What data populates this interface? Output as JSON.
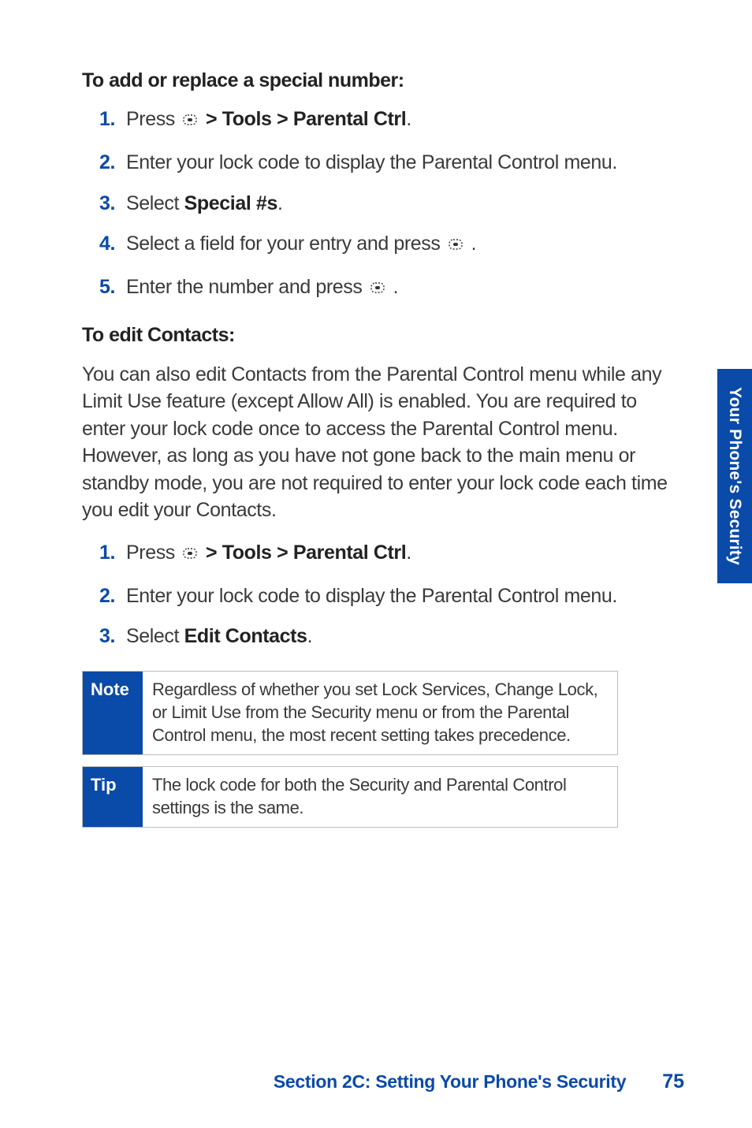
{
  "sideTab": "Your Phone's Security",
  "section1": {
    "heading": "To add or replace a special number:",
    "steps": [
      {
        "num": "1.",
        "pre": "Press ",
        "bold": " > Tools > Parental Ctrl",
        "post": ".",
        "icon": true
      },
      {
        "num": "2.",
        "text": "Enter your lock code to display the Parental Control menu."
      },
      {
        "num": "3.",
        "pre": "Select ",
        "bold": "Special #s",
        "post": "."
      },
      {
        "num": "4.",
        "pre": "Select a field for your entry and press ",
        "post": " .",
        "iconAfter": true
      },
      {
        "num": "5.",
        "pre": "Enter the number and press ",
        "post": " .",
        "iconAfter": true
      }
    ]
  },
  "section2": {
    "heading": "To edit Contacts:",
    "para": "You can also edit Contacts from the Parental Control menu while any Limit Use feature (except Allow All) is enabled. You are required to enter your lock code once to access the Parental Control menu. However, as long as you have not gone back to the main menu or standby mode, you are not required to enter your lock code each time you edit your Contacts.",
    "steps": [
      {
        "num": "1.",
        "pre": "Press ",
        "bold": " > Tools > Parental Ctrl",
        "post": ".",
        "icon": true
      },
      {
        "num": "2.",
        "text": "Enter your lock code to display the Parental Control menu."
      },
      {
        "num": "3.",
        "pre": "Select ",
        "bold": "Edit Contacts",
        "post": "."
      }
    ]
  },
  "note": {
    "label": "Note",
    "body": "Regardless of whether you set Lock Services, Change Lock, or Limit Use from the Security menu or from the Parental Control menu, the most recent setting takes precedence."
  },
  "tip": {
    "label": "Tip",
    "body": "The lock code for both the Security and Parental Control settings is the same."
  },
  "footer": {
    "section": "Section 2C: Setting Your Phone's Security",
    "page": "75"
  }
}
